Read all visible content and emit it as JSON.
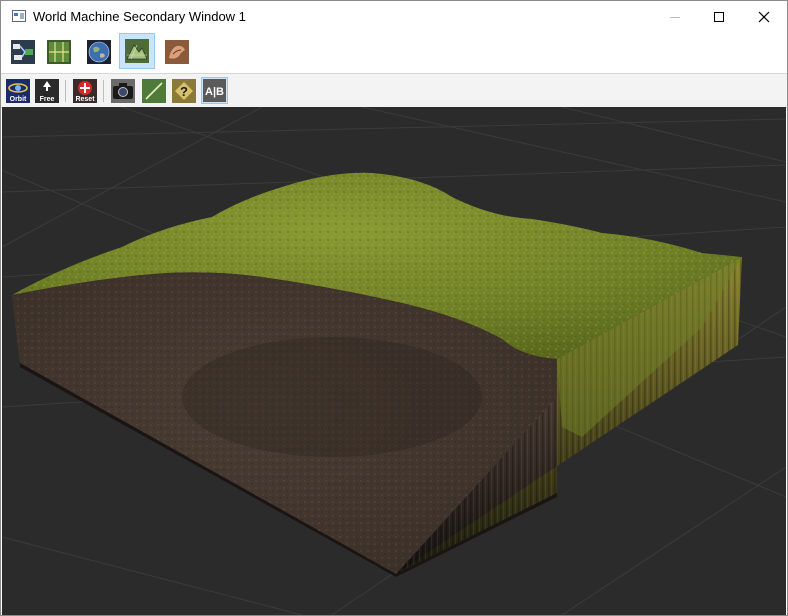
{
  "window": {
    "title": "World Machine Secondary Window 1"
  },
  "toolbar_top": {
    "buttons": [
      {
        "name": "device-view",
        "icon": "device-network-icon",
        "active": false
      },
      {
        "name": "layout-view",
        "icon": "layout-grid-icon",
        "active": false
      },
      {
        "name": "explorer-view",
        "icon": "globe-icon",
        "active": false
      },
      {
        "name": "terrain-3d-view",
        "icon": "terrain-preview-icon",
        "active": true
      },
      {
        "name": "texture-view",
        "icon": "texture-hand-icon",
        "active": false
      }
    ]
  },
  "toolbar_bottom": {
    "buttons": [
      {
        "name": "orbit",
        "label": "Orbit",
        "icon": "orbit-icon",
        "active": false
      },
      {
        "name": "free",
        "label": "Free",
        "icon": "free-camera-icon",
        "active": false
      },
      {
        "name": "reset",
        "label": "Reset",
        "icon": "reset-icon",
        "active": false
      },
      {
        "name": "snapshot",
        "icon": "camera-icon",
        "active": false
      },
      {
        "name": "wireframe",
        "icon": "line-icon",
        "active": false
      },
      {
        "name": "help",
        "icon": "help-icon",
        "active": false
      },
      {
        "name": "ab-compare",
        "label": "A|B",
        "icon": "ab-compare-icon",
        "active": true
      }
    ]
  },
  "colors": {
    "viewport_bg": "#2b2b2b",
    "grid_line": "#3a3a3a",
    "grass": "#7a8a2a",
    "dirt": "#4a3b30",
    "active_button": "#cce4f7"
  }
}
